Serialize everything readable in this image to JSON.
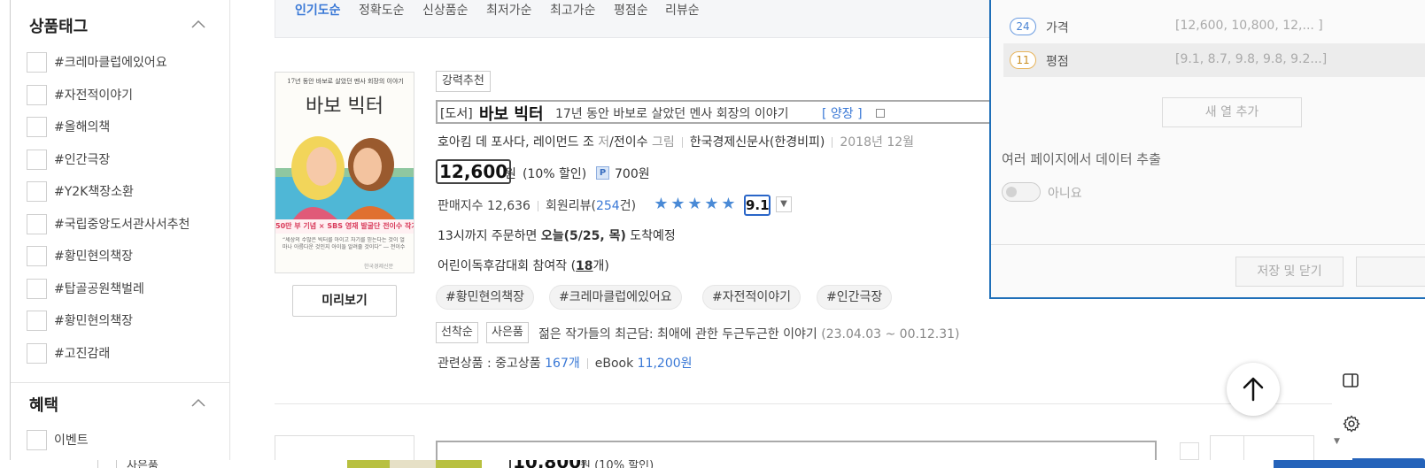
{
  "below": {
    "tag_label": "사은품",
    "price": "10,800",
    "discount": "원 (10% 할인)"
  },
  "sidebar": {
    "tags_title": "상품태그",
    "tags": [
      "#크레마클럽에있어요",
      "#자전적이야기",
      "#올해의책",
      "#인간극장",
      "#Y2K책장소환",
      "#국립중앙도서관사서추천",
      "#황민현의책장",
      "#탑골공원책벌레",
      "#황민현의책장",
      "#고진감래"
    ],
    "benefit_title": "혜택",
    "benefit_items": [
      "이벤트"
    ]
  },
  "sort_options": [
    {
      "label": "인기도순",
      "active": true
    },
    {
      "label": "정확도순",
      "active": false
    },
    {
      "label": "신상품순",
      "active": false
    },
    {
      "label": "최저가순",
      "active": false
    },
    {
      "label": "최고가순",
      "active": false
    },
    {
      "label": "평점순",
      "active": false
    },
    {
      "label": "리뷰순",
      "active": false
    }
  ],
  "book": {
    "cover": {
      "top_caption": "17년 동안 바보로 살았던 멘사 회장의 이야기",
      "title": "바보 빅터",
      "banner": "50만 부 기념 × SBS 영재 발굴단 전이수 작가",
      "quote": "“세상의 수많은 빅터를 아이고 자기를 믿는다는 것이 얼마나 아름다운 것인지 아이들 알려줄 것이다” ― 전이수",
      "publisher": "한국경제신문"
    },
    "preview_label": "미리보기",
    "recommend_badge": "강력추천",
    "category": "[도서]",
    "title": "바보 빅터",
    "subtitle": "17년 동안 바보로 살았던 멘사 회장의 이야기",
    "binding": "[ 양장 ]",
    "author": "호아킴 데 포사다",
    "author2": "레이먼드 조",
    "author_role": "저",
    "translator": "전이수",
    "translator_role": "그림",
    "publisher": "한국경제신문사(한경비피)",
    "pub_date": "2018년 12월",
    "price": "12,600",
    "price_unit": "원",
    "discount": "(10% 할인)",
    "point_badge": "P",
    "point": "700원",
    "sales_label": "판매지수 12,636",
    "review_label": "회원리뷰(",
    "review_count": "254",
    "review_suffix": "건)",
    "rating_stars": 5,
    "rating": "9.1",
    "delivery_prefix": "13시까지 주문하면 ",
    "delivery_bold": "오늘(5/25, 목)",
    "delivery_suffix": " 도착예정",
    "award_prefix": "어린이독후감대회 참여작 (",
    "award_count": "18",
    "award_suffix": "개)",
    "tags": [
      "#황민현의책장",
      "#크레마클럽에있어요",
      "#자전적이야기",
      "#인간극장"
    ],
    "event_badges": [
      "선착순",
      "사은품"
    ],
    "event_text": "젊은 작가들의 최근담: 최애에 관한 두근두근한 이야기",
    "event_period": "(23.04.03 ~ 00.12.31)",
    "related_prefix": "관련상품 : 중고상품",
    "related_used": "167개",
    "related_ebook_label": "eBook",
    "related_ebook_price": "11,200원"
  },
  "dialog": {
    "rows": [
      {
        "count": "24",
        "name": "가격",
        "value": "[12,600, 10,800, 12,... ]",
        "color": "blue"
      },
      {
        "count": "11",
        "name": "평점",
        "value": "[9.1, 8.7, 9.8, 9.8, 9.2...]",
        "color": "orange"
      }
    ],
    "add_column": "새 열 추가",
    "multi_page_label": "여러 페이지에서 데이터 추출",
    "toggle_label": "아니요",
    "save_close": "저장 및 닫기"
  },
  "colors": {
    "accent_blue": "#3978d6",
    "dialog_border": "#1f6fb8",
    "star": "#4a8ad6"
  }
}
